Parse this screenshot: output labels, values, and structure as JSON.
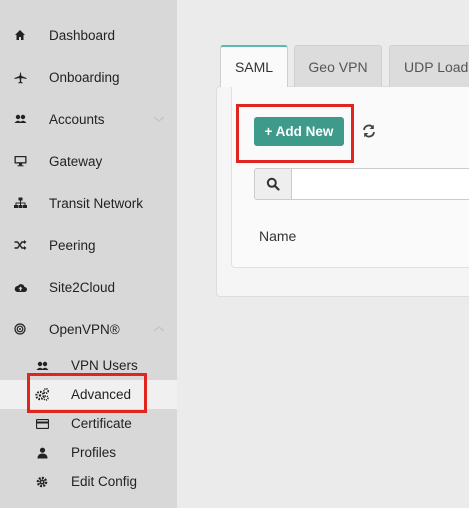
{
  "sidebar": {
    "items": [
      {
        "label": "Dashboard",
        "icon": "home-icon"
      },
      {
        "label": "Onboarding",
        "icon": "plane-icon"
      },
      {
        "label": "Accounts",
        "icon": "users-icon"
      },
      {
        "label": "Gateway",
        "icon": "desktop-icon"
      },
      {
        "label": "Transit Network",
        "icon": "sitemap-icon"
      },
      {
        "label": "Peering",
        "icon": "shuffle-icon"
      },
      {
        "label": "Site2Cloud",
        "icon": "cloud-upload-icon"
      },
      {
        "label": "OpenVPN®",
        "icon": "openvpn-icon"
      }
    ],
    "openvpn_subitems": [
      {
        "label": "VPN Users",
        "icon": "users-icon"
      },
      {
        "label": "Advanced",
        "icon": "cogs-icon",
        "active": true
      },
      {
        "label": "Certificate",
        "icon": "credit-card-icon"
      },
      {
        "label": "Profiles",
        "icon": "user-icon"
      },
      {
        "label": "Edit Config",
        "icon": "gear-icon"
      }
    ]
  },
  "tabs": [
    {
      "label": "SAML",
      "active": true
    },
    {
      "label": "Geo VPN"
    },
    {
      "label": "UDP Loadl"
    }
  ],
  "toolbar": {
    "add_label": "+ Add New"
  },
  "search": {
    "value": "",
    "placeholder": ""
  },
  "table": {
    "columns": [
      "Name"
    ]
  },
  "colors": {
    "accent": "#3e9b8b",
    "highlight": "#e0251f",
    "sidebar_bg": "#d8d8d8"
  }
}
